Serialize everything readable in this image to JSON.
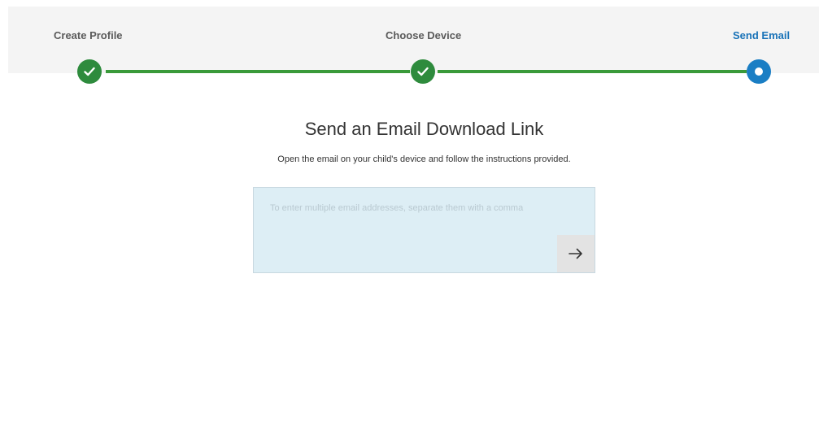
{
  "stepper": {
    "steps": [
      {
        "label": "Create Profile",
        "status": "completed",
        "icon": "check-icon"
      },
      {
        "label": "Choose Device",
        "status": "completed",
        "icon": "check-icon"
      },
      {
        "label": "Send Email",
        "status": "current",
        "icon": "current-step-icon"
      }
    ],
    "colors": {
      "completed": "#2e8b3d",
      "current": "#1a7ec4",
      "line": "#3a9a3a",
      "active_label": "#1a73b8"
    }
  },
  "main": {
    "title": "Send an Email Download Link",
    "subtitle": "Open the email on your child's device and follow the instructions provided.",
    "email_input": {
      "placeholder": "To enter multiple email addresses, separate them with a comma",
      "value": ""
    },
    "send_button": {
      "icon": "arrow-right-icon"
    }
  }
}
